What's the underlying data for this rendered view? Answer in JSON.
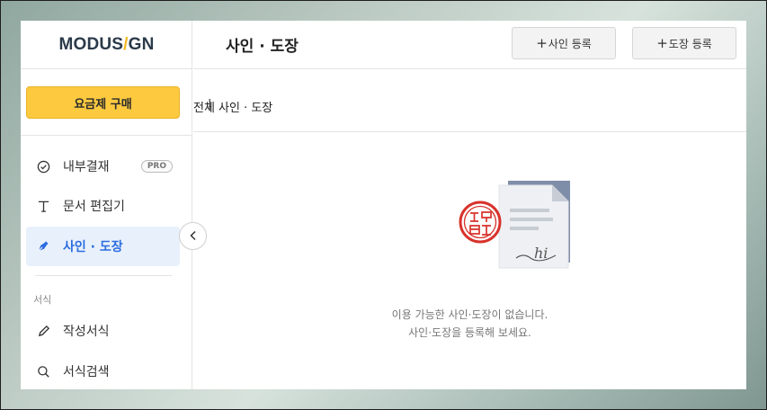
{
  "app": {
    "logo_left": "MODUS",
    "logo_slash": "/",
    "logo_right": "GN"
  },
  "sidebar": {
    "buy_button": "요금제 구매",
    "items": [
      {
        "label": "내부결재",
        "icon": "check-circle-icon",
        "badge": "PRO"
      },
      {
        "label": "문서 편집기",
        "icon": "text-icon"
      },
      {
        "label": "사인 · 도장",
        "icon": "pen-icon",
        "active": true
      }
    ],
    "section_label": "서식",
    "section_items": [
      {
        "label": "작성서식",
        "icon": "pencil-icon"
      },
      {
        "label": "서식검색",
        "icon": "search-icon"
      }
    ]
  },
  "header": {
    "title": "사인 · 도장",
    "add_sign_button": "사인 등록",
    "add_stamp_button": "도장 등록",
    "plus_glyph": "+"
  },
  "tabs": {
    "all_partial": "전체",
    "separator": "|",
    "sign_stamp": "사인 · 도장"
  },
  "empty_state": {
    "line1": "이용 가능한 사인·도장이 없습니다.",
    "line2": "사인·도장을 등록해 보세요.",
    "signature_text": "hi"
  },
  "colors": {
    "accent": "#2b6de0",
    "buy_button": "#fcc93f",
    "stamp_red": "#d8322b"
  }
}
